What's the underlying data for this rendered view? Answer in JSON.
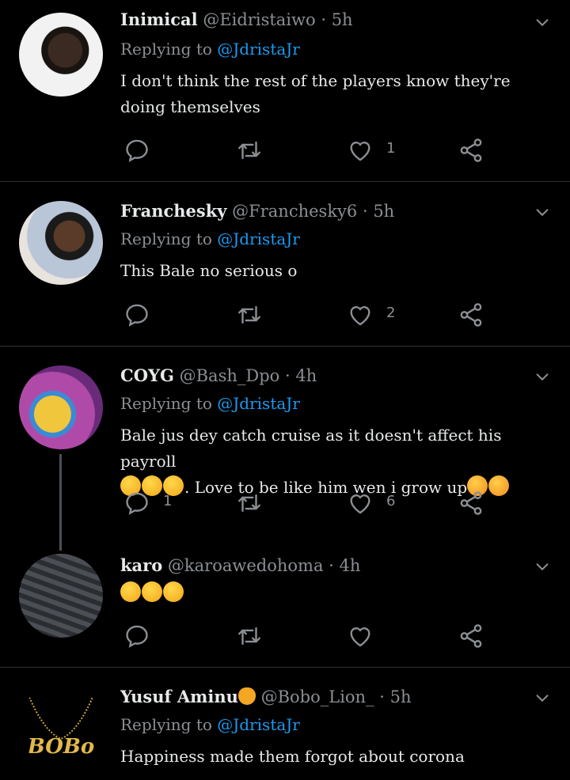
{
  "tweets": [
    {
      "name": "Inimical",
      "handle": "@Eidristaiwo",
      "time": "· 5h",
      "reply_prefix": "Replying to",
      "reply_to": "@JdristaJr",
      "text": "I don't think the rest of the players know they're doing themselves",
      "likes": "1",
      "replies": "",
      "avatar_icon": "person-photo"
    },
    {
      "name": "Franchesky",
      "handle": "@Franchesky6",
      "time": "· 5h",
      "reply_prefix": "Replying to",
      "reply_to": "@JdristaJr",
      "text": "This Bale no serious o",
      "likes": "2",
      "replies": "",
      "avatar_icon": "person-photo"
    },
    {
      "name": "COYG",
      "handle": "@Bash_Dpo",
      "time": "· 4h",
      "reply_prefix": "Replying to",
      "reply_to": "@JdristaJr",
      "text_line1": "Bale jus dey catch cruise as it doesn't affect his payroll",
      "text_line2": ". Love to be like him wen i grow up",
      "likes": "6",
      "replies": "1",
      "avatar_icon": "cartoon-avatar"
    },
    {
      "name": "karo",
      "handle": "@karoawedohoma",
      "time": "· 4h",
      "likes": "",
      "replies": "",
      "avatar_icon": "keyboard-photo"
    },
    {
      "name": "Yusuf Aminu",
      "handle": "@Bobo_Lion_",
      "time": "· 5h",
      "reply_prefix": "Replying to",
      "reply_to": "@JdristaJr",
      "text": "Happiness made them forgot about corona",
      "avatar_text": "BOBo",
      "avatar_icon": "gold-necklace-logo"
    }
  ],
  "colors": {
    "background": "#000000",
    "link": "#1d9bf0",
    "muted": "#8b8f94",
    "divider": "#2f3336"
  }
}
